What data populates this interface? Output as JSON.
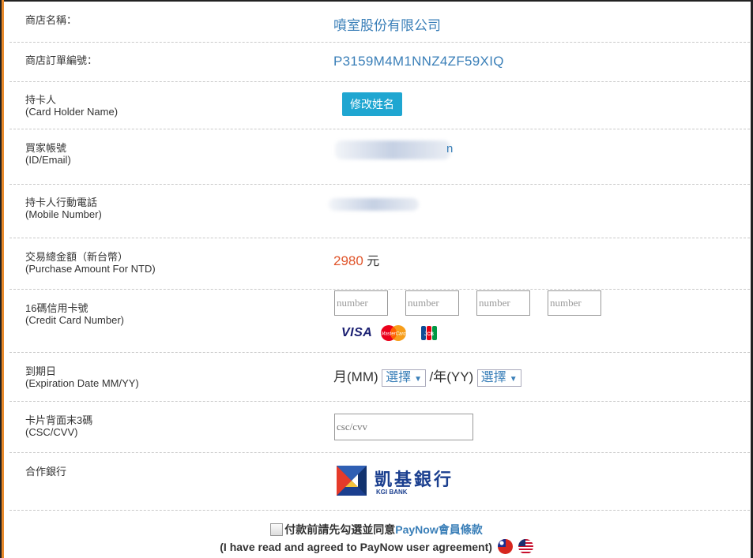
{
  "store": {
    "name_label": "商店名稱：",
    "name_value": "噴室股份有限公司",
    "order_label": "商店訂單編號：",
    "order_value": "P3159M4M1NNZ4ZF59XIQ"
  },
  "holder": {
    "label_zh": "持卡人",
    "label_en": "(Card Holder Name)",
    "edit_button": "修改姓名"
  },
  "buyer": {
    "label_zh": "買家帳號",
    "label_en": "(ID/Email)",
    "visible_tail": "n"
  },
  "mobile": {
    "label_zh": "持卡人行動電話",
    "label_en": "(Mobile Number)"
  },
  "amount": {
    "label_zh": "交易總金額（新台幣）",
    "label_en": "(Purchase Amount For NTD)",
    "value": "2980",
    "unit": "元"
  },
  "card": {
    "label_zh": "16碼信用卡號",
    "label_en": "(Credit Card Number)",
    "placeholders": [
      "number",
      "number",
      "number",
      "number"
    ],
    "brands": [
      "VISA",
      "MasterCard",
      "JCB"
    ]
  },
  "expiry": {
    "label_zh": "到期日",
    "label_en": "(Expiration Date MM/YY)",
    "month_label": "月(MM)",
    "separator": "/",
    "year_label": "年(YY)",
    "month_select": "選擇",
    "year_select": "選擇"
  },
  "csc": {
    "label_zh": "卡片背面末3碼",
    "label_en": "(CSC/CVV)",
    "placeholder": "csc/cvv"
  },
  "bank": {
    "label_zh": "合作銀行",
    "name_zh": "凱基銀行",
    "name_en": "KGI BANK"
  },
  "agreement": {
    "text_zh": "付款前請先勾選並同意",
    "link_text": "PayNow會員條款",
    "text_en": "(I have read and agreed to PayNow user agreement)"
  },
  "colors": {
    "accent_blue": "#3a7fb8",
    "button_blue": "#1fa6d1",
    "amount_orange": "#e0552b",
    "frame_orange": "#e88a2c"
  }
}
